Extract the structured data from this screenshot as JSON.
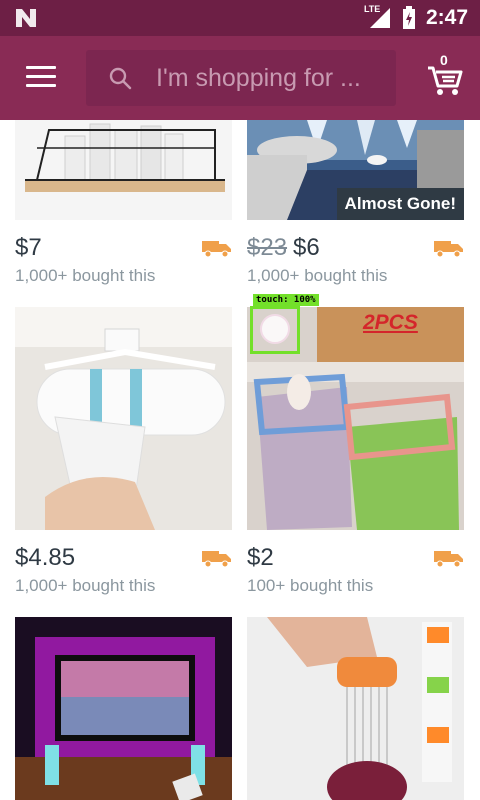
{
  "status_bar": {
    "network": "LTE",
    "time": "2:47"
  },
  "search": {
    "placeholder": "I'm shopping for ..."
  },
  "cart": {
    "count": "0"
  },
  "colors": {
    "app_bar": "#892b55",
    "status_bar": "#6d1f45",
    "truck": "#f0a04a",
    "touch_indicator": "#73e02a"
  },
  "products": [
    {
      "price": "$7",
      "old_price": "",
      "bought": "1,000+ bought this",
      "badge": ""
    },
    {
      "price": "$6",
      "old_price": "$23",
      "bought": "1,000+ bought this",
      "badge": "Almost Gone!"
    },
    {
      "price": "$4.85",
      "old_price": "",
      "bought": "1,000+ bought this",
      "badge": ""
    },
    {
      "price": "$2",
      "old_price": "",
      "bought": "100+ bought this",
      "badge": "",
      "image_text": "2PCS"
    }
  ],
  "touch_overlay": {
    "label": "touch: 100%"
  }
}
